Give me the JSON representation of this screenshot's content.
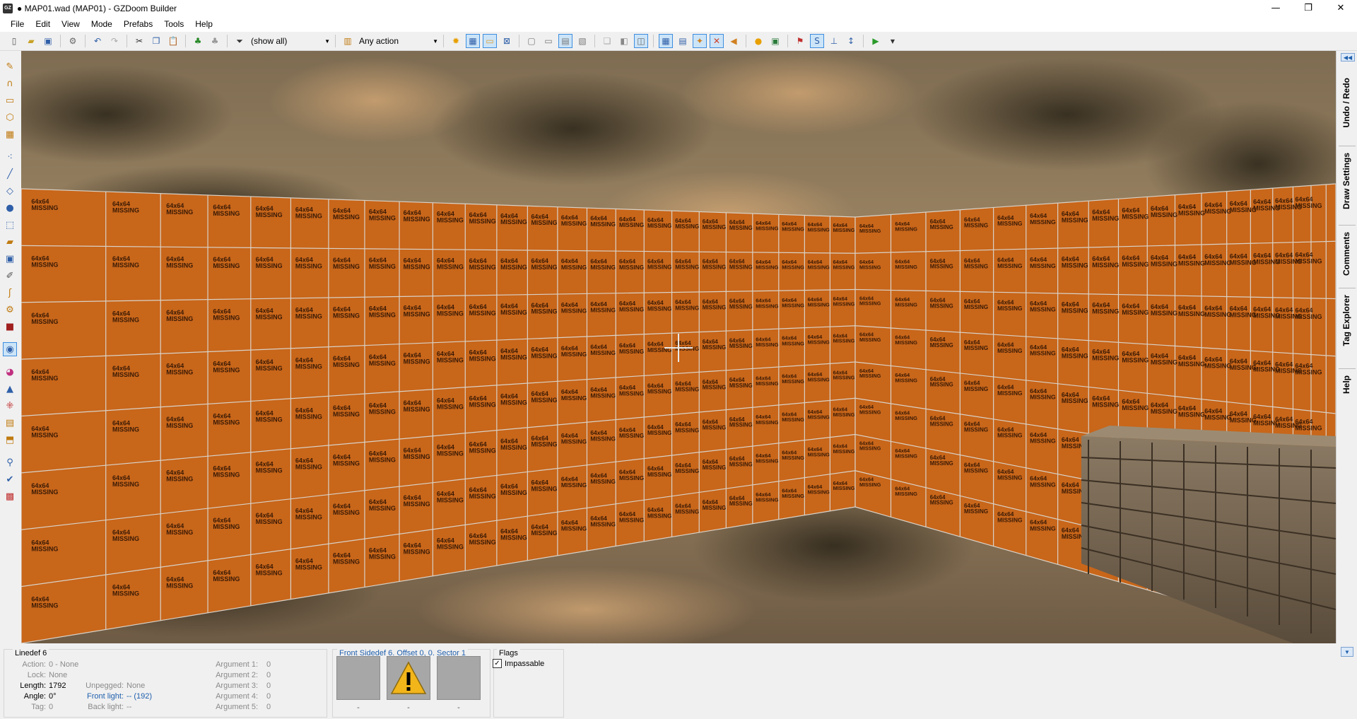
{
  "window": {
    "title": "● MAP01.wad (MAP01) - GZDoom Builder",
    "app_icon": "GZ",
    "minimize": "—",
    "maximize": "❐",
    "close": "✕"
  },
  "menu": [
    "File",
    "Edit",
    "View",
    "Mode",
    "Prefabs",
    "Tools",
    "Help"
  ],
  "toolbar": {
    "filter_value": "(show all)",
    "action_value": "Any action"
  },
  "viewport": {
    "wall_texture_text_line1": "64x64",
    "wall_texture_text_line2": "MISSING",
    "colors": {
      "missing_texture": "#c8661a",
      "grid_line": "#d9d2c8",
      "sky": "#6b5a44"
    }
  },
  "right_dock": {
    "tabs": [
      "Undo / Redo",
      "Draw Settings",
      "Comments",
      "Tag Explorer",
      "Help"
    ]
  },
  "info": {
    "title": "Linedef 6",
    "action_label": "Action:",
    "action_value": "0 - None",
    "lock_label": "Lock:",
    "lock_value": "None",
    "length_label": "Length:",
    "length_value": "1792",
    "angle_label": "Angle:",
    "angle_value": "0°",
    "tag_label": "Tag:",
    "tag_value": "0",
    "unpegged_label": "Unpegged:",
    "unpegged_value": "None",
    "front_light_label": "Front light:",
    "front_light_value": "-- (192)",
    "back_light_label": "Back light:",
    "back_light_value": "--",
    "arguments": [
      {
        "label": "Argument 1:",
        "value": "0"
      },
      {
        "label": "Argument 2:",
        "value": "0"
      },
      {
        "label": "Argument 3:",
        "value": "0"
      },
      {
        "label": "Argument 4:",
        "value": "0"
      },
      {
        "label": "Argument 5:",
        "value": "0"
      }
    ],
    "front_sidedef_title": "Front Sidedef 6. Offset 0, 0. Sector 1",
    "texture_labels": [
      "-",
      "-",
      "-"
    ],
    "flags_title": "Flags",
    "flag_impassable": "Impassable"
  }
}
